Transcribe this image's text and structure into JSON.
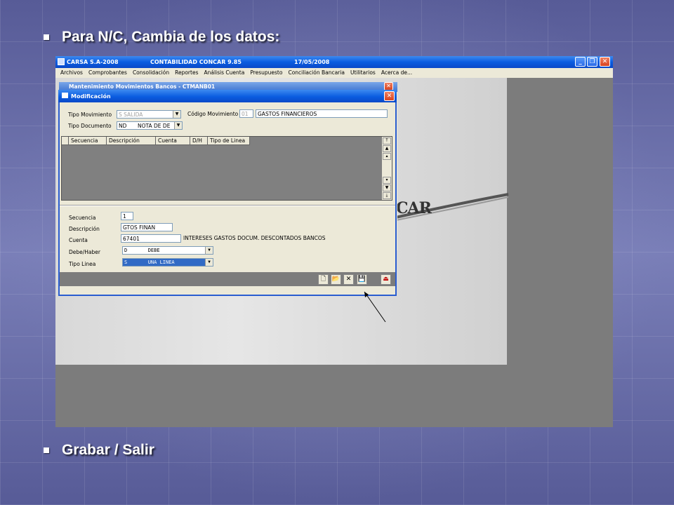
{
  "slide": {
    "bullet1": "Para N/C, Cambia de los datos:",
    "bullet2": "Grabar / Salir"
  },
  "app": {
    "title_left": "CARSA S.A-2008",
    "title_mid": "CONTABILIDAD CONCAR 9.85",
    "title_date": "17/05/2008",
    "menu": [
      "Archivos",
      "Comprobantes",
      "Consolidación",
      "Reportes",
      "Análisis Cuenta",
      "Presupuesto",
      "Conciliación Bancaria",
      "Utilitarios",
      "Acerca de..."
    ],
    "background_window_title": "Mantenimiento Movimientos Bancos - CTMANB01",
    "logo_text": "CAR"
  },
  "dialog": {
    "title": "Modificación",
    "tipo_movimiento_label": "Tipo Movimiento",
    "tipo_movimiento_value": "S  SALIDA",
    "codigo_movimiento_label": "Código Movimiento",
    "codigo_movimiento_value": "01",
    "codigo_movimiento_desc": "GASTOS FINANCIEROS",
    "tipo_documento_label": "Tipo Documento",
    "tipo_documento_code": "ND",
    "tipo_documento_desc": "NOTA DE DE",
    "grid_columns": [
      "Secuencia",
      "Descripción",
      "Cuenta",
      "D/H",
      "Tipo de Linea"
    ],
    "secuencia_label": "Secuencia",
    "secuencia_value": "1",
    "descripcion_label": "Descripción",
    "descripcion_value": "GTOS FINAN",
    "cuenta_label": "Cuenta",
    "cuenta_value": "67401",
    "cuenta_desc": "INTERESES GASTOS DOCUM. DESCONTADOS BANCOS",
    "debe_haber_label": "Debe/Haber",
    "debe_haber_value": "D       DEBE",
    "tipo_linea_label": "Tipo Linea",
    "tipo_linea_value": "S       UNA LINEA"
  },
  "toolbar_icons": [
    "new-icon",
    "open-icon",
    "delete-icon",
    "save-icon",
    "exit-icon"
  ],
  "colors": {
    "title_blue": "#0a5ce0",
    "close_red": "#d84420",
    "selection_blue": "#316ac5",
    "slide_bg": "#5b5f9c"
  }
}
